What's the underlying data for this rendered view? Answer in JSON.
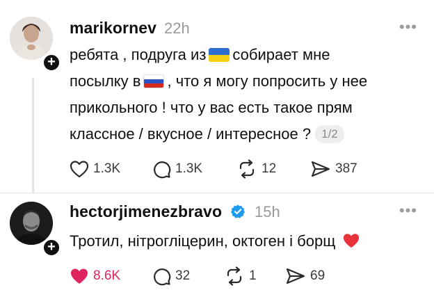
{
  "posts": [
    {
      "username": "marikornev",
      "time": "22h",
      "text": {
        "l1_a": "ребята , подруга из",
        "l1_b": "собирает мне",
        "l2_a": "посылку в",
        "l2_b": ", что я могу попросить у нее",
        "l3": "прикольного ! что у вас есть такое прям",
        "l4": "классное / вкусное / интересное ?"
      },
      "flag_1": "ukraine-flag-emoji",
      "flag_2": "russia-flag-emoji",
      "pager": "1/2",
      "likes": "1.3K",
      "replies": "1.3K",
      "reposts": "12",
      "shares": "387"
    },
    {
      "username": "hectorjimenezbravo",
      "time": "15h",
      "verified": true,
      "text": "Тротил, нітрогліцерин, октоген і борщ",
      "emoji": "red-heart",
      "likes": "8.6K",
      "liked": true,
      "replies": "32",
      "reposts": "1",
      "shares": "69"
    }
  ],
  "colors": {
    "like_active": "#e0245e",
    "muted": "#9a9a9a",
    "verified": "#1d9bf0"
  }
}
